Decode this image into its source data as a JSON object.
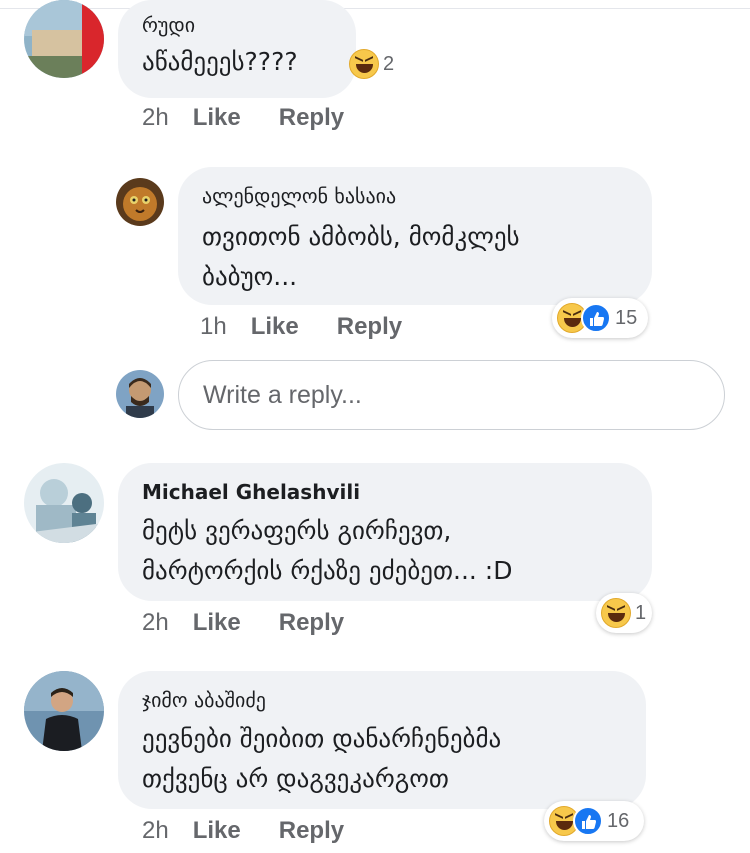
{
  "comments": [
    {
      "author": "რუდი",
      "lines": [
        "აწამეეეს????"
      ],
      "reactions": {
        "count": "2"
      },
      "time": "2h",
      "like": "Like",
      "reply": "Reply"
    },
    {
      "author": "ალენდელონ ხასაია",
      "lines": [
        "თვითონ ამბობს, მომკლეს",
        "ბაბუო..."
      ],
      "reactions": {
        "count": "15"
      },
      "time": "1h",
      "like": "Like",
      "reply": "Reply"
    },
    {
      "author": "Michael Ghelashvili",
      "lines": [
        "მეტს ვერაფერს გირჩევთ,",
        "მარტორქის რქაზე ეძებეთ... :D"
      ],
      "reactions": {
        "count": "1"
      },
      "time": "2h",
      "like": "Like",
      "reply": "Reply"
    },
    {
      "author": "ჯიმო აბაშიძე",
      "lines": [
        "ეევნები შეიბით დანარჩენებმა",
        "თქვენც არ დაგვეკარგოთ"
      ],
      "reactions": {
        "count": "16"
      },
      "time": "2h",
      "like": "Like",
      "reply": "Reply"
    }
  ],
  "reply_box": {
    "placeholder": "Write a reply..."
  },
  "colors": {
    "bubble": "#f0f2f5",
    "like_blue": "#1877f2",
    "haha_yellow": "#f7c84b",
    "meta_gray": "#65676b"
  }
}
